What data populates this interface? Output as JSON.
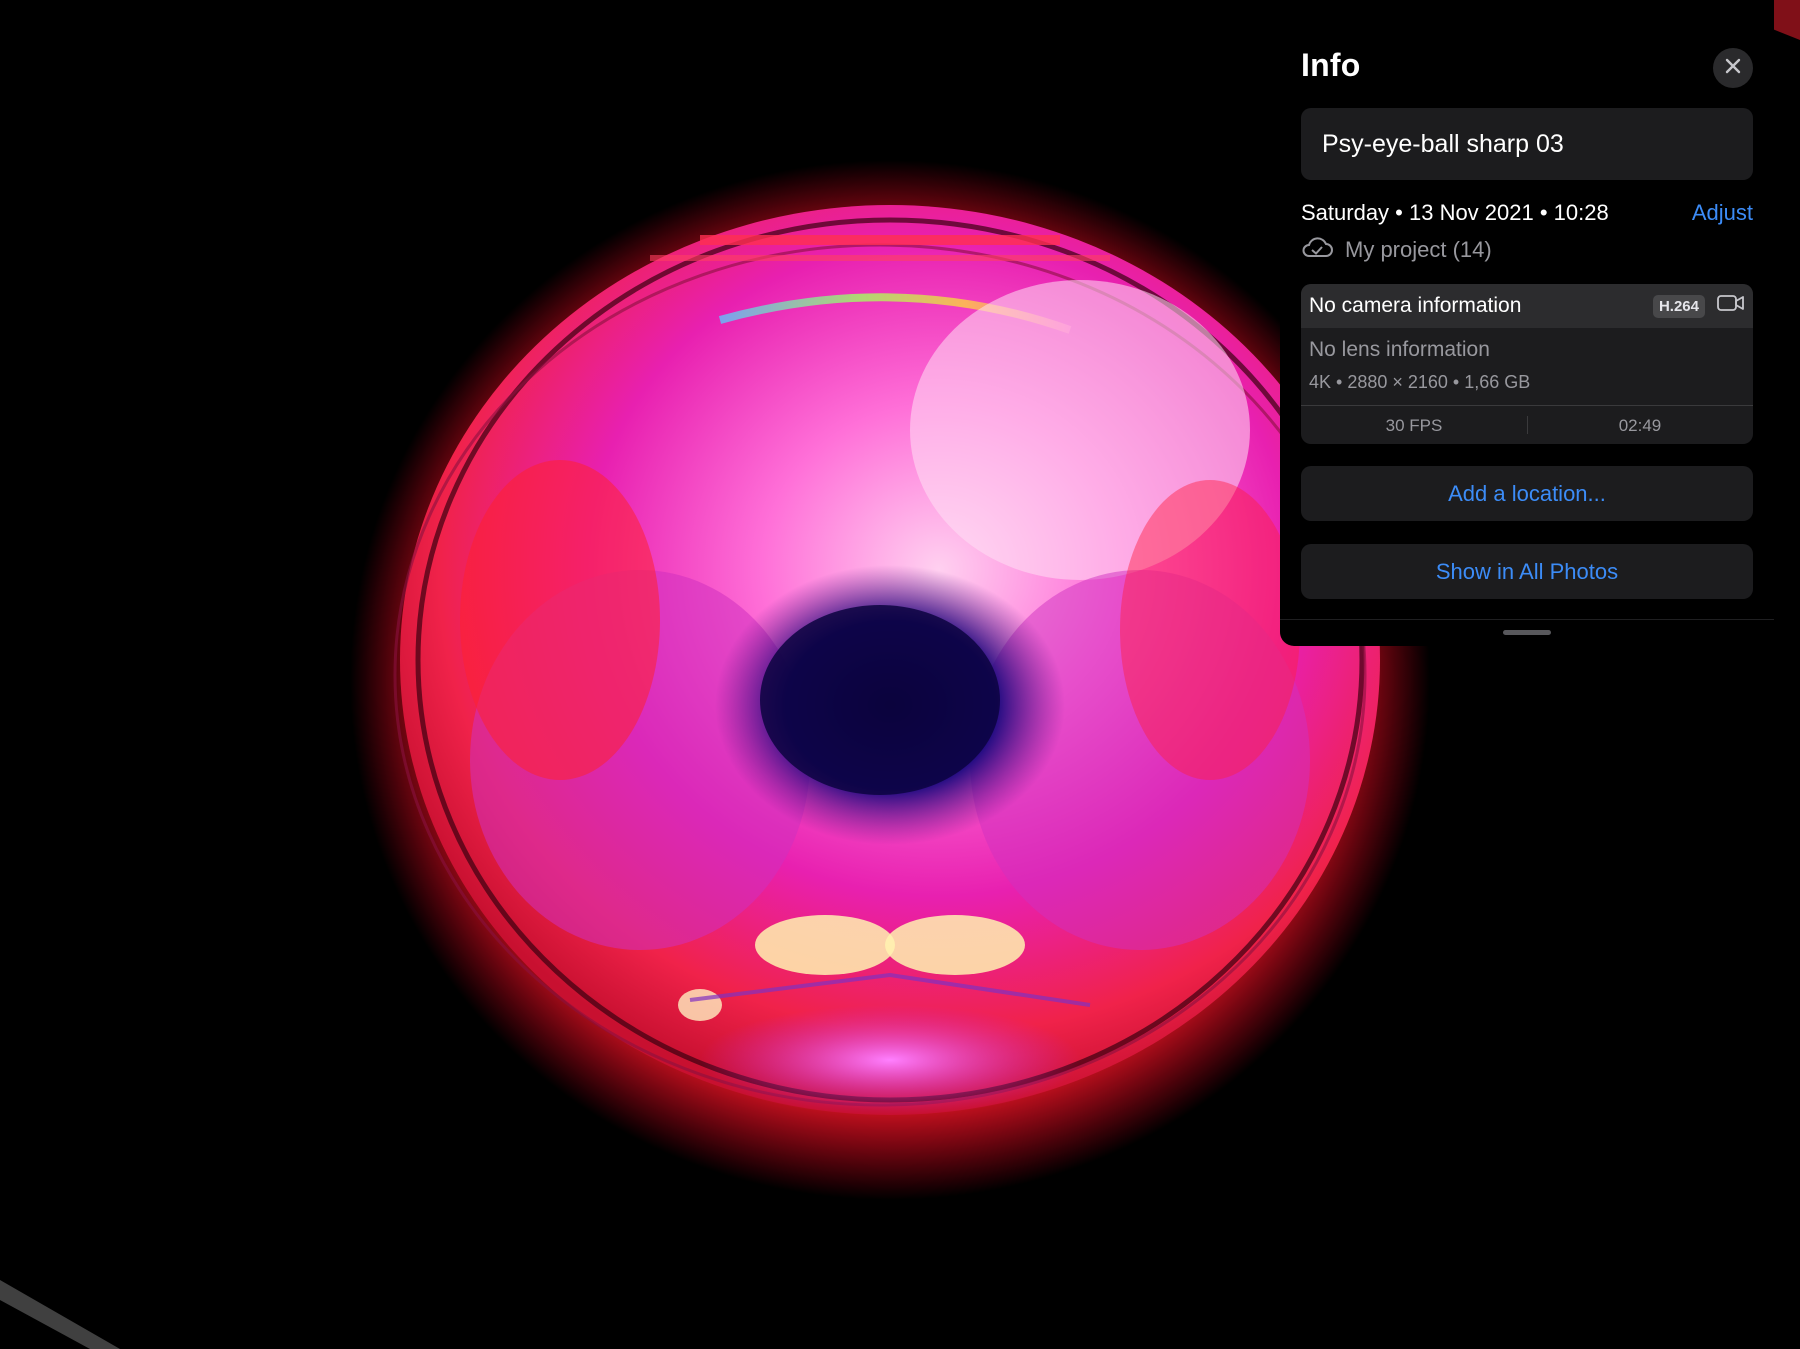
{
  "panel": {
    "title": "Info",
    "photo_title": "Psy-eye-ball sharp 03",
    "date_line": "Saturday • 13 Nov 2021 • 10:28",
    "adjust_label": "Adjust",
    "album_label": "My project (14)",
    "camera": {
      "camera_info": "No camera information",
      "codec": "H.264",
      "lens_info": "No lens information",
      "specs": "4K • 2880 × 2160 • 1,66 GB",
      "fps": "30 FPS",
      "duration": "02:49"
    },
    "add_location_label": "Add a location...",
    "show_in_all_label": "Show in All Photos"
  },
  "icons": {
    "close": "close-icon",
    "cloud": "cloud-check-icon",
    "video": "video-camera-icon"
  },
  "colors": {
    "accent": "#3c8cf7",
    "panel_bg": "#000000",
    "card_bg": "#1c1c1e",
    "secondary_text": "#98989e"
  }
}
